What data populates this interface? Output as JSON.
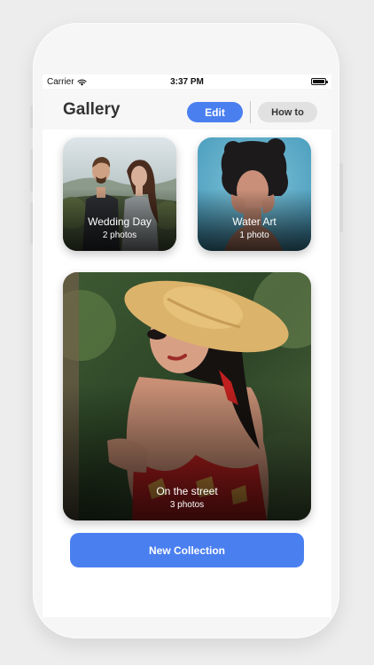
{
  "status_bar": {
    "carrier": "Carrier",
    "time": "3:37 PM",
    "icons": [
      "wifi-icon",
      "battery-icon"
    ]
  },
  "header": {
    "title": "Gallery",
    "edit_label": "Edit",
    "howto_label": "How to"
  },
  "collections": [
    {
      "name": "Wedding Day",
      "count": "2 photos"
    },
    {
      "name": "Water Art",
      "count": "1 photo"
    },
    {
      "name": "On the street",
      "count": "3 photos"
    }
  ],
  "footer": {
    "new_collection_label": "New Collection"
  },
  "colors": {
    "accent": "#4a7ff0",
    "secondary_button": "#e1e1e1",
    "background": "#ffffff"
  }
}
